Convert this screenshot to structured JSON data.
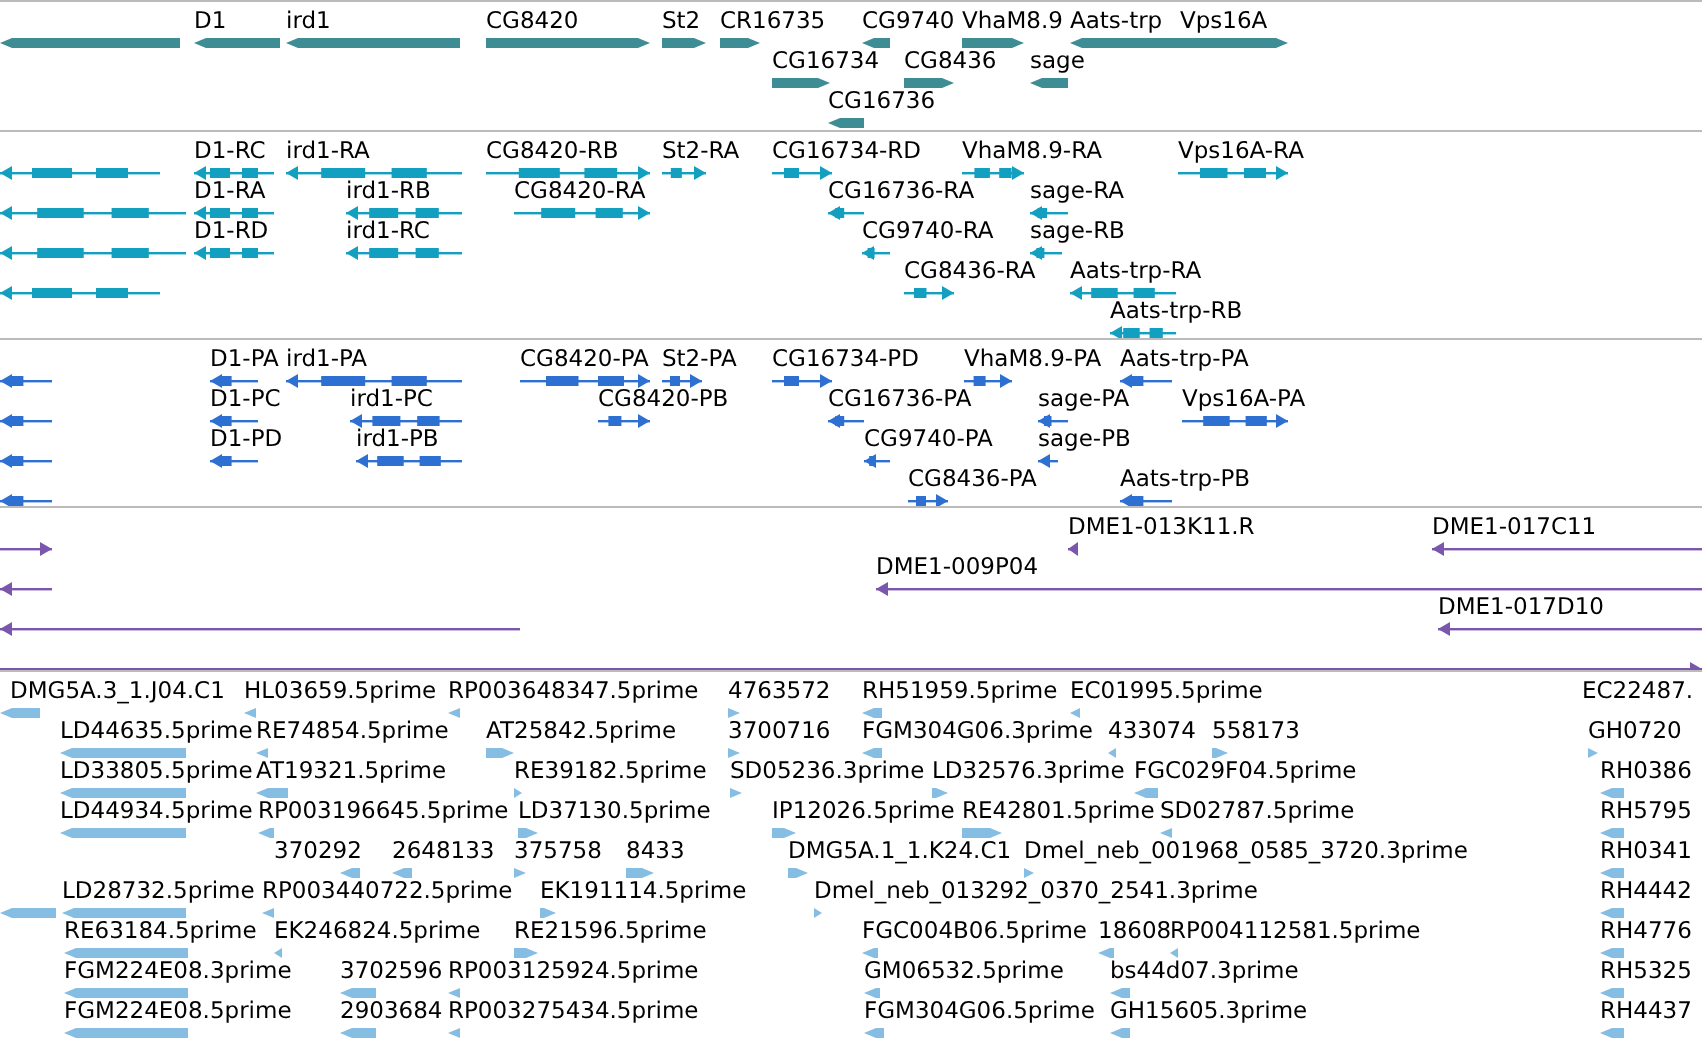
{
  "tracks": [
    {
      "kind": "gene",
      "features": [
        {
          "kind": "reverse"
        },
        {
          "label": "D1",
          "kind": "reverse"
        },
        {
          "label": "ird1",
          "kind": "reverse"
        },
        {
          "label": "CG8420",
          "kind": "forward"
        },
        {
          "label": "St2",
          "kind": "forward"
        },
        {
          "label": "CR16735",
          "kind": "forward"
        },
        {
          "label": "CG9740",
          "kind": "reverse"
        },
        {
          "label": "VhaM8.9",
          "kind": "forward"
        },
        {
          "label": "Aats-trp",
          "kind": "reverse"
        },
        {
          "label": "Vps16A",
          "kind": "forward"
        },
        {
          "label": "CG16734",
          "kind": "forward"
        },
        {
          "label": "CG8436",
          "kind": "forward"
        },
        {
          "label": "sage",
          "kind": "reverse"
        },
        {
          "label": "CG16736",
          "kind": "reverse"
        }
      ]
    },
    {
      "kind": "transcript",
      "features": [
        {
          "kind": "reverse"
        },
        {
          "label": "D1-RC",
          "kind": "reverse"
        },
        {
          "label": "ird1-RA",
          "kind": "reverse"
        },
        {
          "label": "CG8420-RB",
          "kind": "forward"
        },
        {
          "label": "St2-RA",
          "kind": "forward"
        },
        {
          "label": "CG16734-RD",
          "kind": "forward"
        },
        {
          "label": "VhaM8.9-RA",
          "kind": "forward"
        },
        {
          "label": "Vps16A-RA",
          "kind": "forward"
        },
        {
          "kind": "reverse"
        },
        {
          "label": "D1-RA",
          "kind": "reverse"
        },
        {
          "label": "ird1-RB",
          "kind": "reverse"
        },
        {
          "label": "CG8420-RA",
          "kind": "forward"
        },
        {
          "label": "CG16736-RA",
          "kind": "reverse"
        },
        {
          "label": "sage-RA",
          "kind": "reverse"
        },
        {
          "kind": "reverse"
        },
        {
          "label": "D1-RD",
          "kind": "reverse"
        },
        {
          "label": "ird1-RC",
          "kind": "reverse"
        },
        {
          "label": "CG9740-RA",
          "kind": "reverse"
        },
        {
          "label": "sage-RB",
          "kind": "reverse"
        },
        {
          "kind": "reverse"
        },
        {
          "label": "CG8436-RA",
          "kind": "forward"
        },
        {
          "label": "Aats-trp-RA",
          "kind": "reverse"
        },
        {
          "label": "Aats-trp-RB",
          "kind": "reverse"
        }
      ]
    },
    {
      "kind": "protein",
      "features": [
        {
          "kind": "reverse"
        },
        {
          "label": "D1-PA",
          "kind": "reverse"
        },
        {
          "label": "ird1-PA",
          "kind": "reverse"
        },
        {
          "label": "CG8420-PA",
          "kind": "forward"
        },
        {
          "label": "St2-PA",
          "kind": "forward"
        },
        {
          "label": "CG16734-PD",
          "kind": "forward"
        },
        {
          "label": "VhaM8.9-PA",
          "kind": "forward"
        },
        {
          "label": "Aats-trp-PA",
          "kind": "reverse"
        },
        {
          "kind": "reverse"
        },
        {
          "label": "D1-PC",
          "kind": "reverse"
        },
        {
          "label": "ird1-PC",
          "kind": "reverse"
        },
        {
          "label": "CG8420-PB",
          "kind": "forward"
        },
        {
          "label": "CG16736-PA",
          "kind": "reverse"
        },
        {
          "label": "sage-PA",
          "kind": "reverse"
        },
        {
          "label": "Vps16A-PA",
          "kind": "forward"
        },
        {
          "kind": "reverse"
        },
        {
          "label": "D1-PD",
          "kind": "reverse"
        },
        {
          "label": "ird1-PB",
          "kind": "reverse"
        },
        {
          "label": "CG9740-PA",
          "kind": "reverse"
        },
        {
          "label": "sage-PB",
          "kind": "reverse"
        },
        {
          "kind": "reverse"
        },
        {
          "label": "CG8436-PA",
          "kind": "forward"
        },
        {
          "label": "Aats-trp-PB",
          "kind": "reverse"
        }
      ]
    },
    {
      "kind": "clone",
      "features": [
        {
          "kind": "forward"
        },
        {
          "label": "DME1-013K11.R",
          "kind": "reverse"
        },
        {
          "label": "DME1-017C11",
          "kind": "reverse"
        },
        {
          "kind": "reverse"
        },
        {
          "label": "DME1-009P04",
          "kind": "reverse"
        },
        {
          "kind": "reverse"
        },
        {
          "label": "DME1-017D10",
          "kind": "reverse"
        },
        {
          "kind": "forward"
        }
      ]
    },
    {
      "kind": "est",
      "features": [
        {
          "label": "DMG5A.3_1.J04.C1",
          "kind": "reverse"
        },
        {
          "label": "HL03659.5prime",
          "kind": "reverse"
        },
        {
          "label": "RP003648347.5prime",
          "kind": "reverse"
        },
        {
          "label": "4763572",
          "kind": "forward"
        },
        {
          "label": "RH51959.5prime",
          "kind": "reverse"
        },
        {
          "label": "EC01995.5prime",
          "kind": "reverse"
        },
        {
          "label": "EC22487."
        },
        {
          "label": "LD44635.5prime",
          "kind": "reverse"
        },
        {
          "label": "RE74854.5prime",
          "kind": "reverse"
        },
        {
          "label": "AT25842.5prime",
          "kind": "forward"
        },
        {
          "label": "3700716",
          "kind": "forward"
        },
        {
          "label": "FGM304G06.3prime",
          "kind": "reverse"
        },
        {
          "label": "433074",
          "kind": "reverse"
        },
        {
          "label": "558173",
          "kind": "forward"
        },
        {
          "label": "GH0720",
          "kind": "forward"
        },
        {
          "label": "LD33805.5prime",
          "kind": "reverse"
        },
        {
          "label": "AT19321.5prime",
          "kind": "reverse"
        },
        {
          "label": "RE39182.5prime",
          "kind": "forward"
        },
        {
          "label": "SD05236.3prime",
          "kind": "forward"
        },
        {
          "label": "LD32576.3prime",
          "kind": "forward"
        },
        {
          "label": "FGC029F04.5prime",
          "kind": "reverse"
        },
        {
          "label": "RH0386",
          "kind": "reverse"
        },
        {
          "label": "LD44934.5prime",
          "kind": "reverse"
        },
        {
          "label": "RP003196645.5prime",
          "kind": "reverse"
        },
        {
          "label": "LD37130.5prime",
          "kind": "forward"
        },
        {
          "label": "IP12026.5prime",
          "kind": "forward"
        },
        {
          "label": "RE42801.5prime",
          "kind": "forward"
        },
        {
          "label": "SD02787.5prime",
          "kind": "reverse"
        },
        {
          "label": "RH5795",
          "kind": "reverse"
        },
        {
          "label": "370292",
          "kind": "reverse"
        },
        {
          "label": "2648133",
          "kind": "reverse"
        },
        {
          "label": "375758",
          "kind": "forward"
        },
        {
          "label": "8433",
          "kind": "forward"
        },
        {
          "label": "DMG5A.1_1.K24.C1",
          "kind": "forward"
        },
        {
          "label": "Dmel_neb_001968_0585_3720.3prime",
          "kind": "forward"
        },
        {
          "label": "RH0341",
          "kind": "reverse"
        },
        {
          "kind": "reverse"
        },
        {
          "label": "LD28732.5prime",
          "kind": "reverse"
        },
        {
          "label": "RP003440722.5prime",
          "kind": "reverse"
        },
        {
          "label": "EK191114.5prime",
          "kind": "forward"
        },
        {
          "label": "Dmel_neb_013292_0370_2541.3prime",
          "kind": "forward"
        },
        {
          "label": "RH4442",
          "kind": "reverse"
        },
        {
          "label": "RE63184.5prime",
          "kind": "reverse"
        },
        {
          "label": "EK246824.5prime",
          "kind": "reverse"
        },
        {
          "label": "RE21596.5prime",
          "kind": "forward"
        },
        {
          "label": "FGC004B06.5prime",
          "kind": "reverse"
        },
        {
          "label": "18608",
          "kind": "reverse"
        },
        {
          "label": "RP004112581.5prime",
          "kind": "reverse"
        },
        {
          "label": "RH4776",
          "kind": "reverse"
        },
        {
          "label": "FGM224E08.3prime",
          "kind": "reverse"
        },
        {
          "label": "3702596",
          "kind": "reverse"
        },
        {
          "label": "RP003125924.5prime",
          "kind": "reverse"
        },
        {
          "label": "GM06532.5prime",
          "kind": "reverse"
        },
        {
          "label": "bs44d07.3prime",
          "kind": "reverse"
        },
        {
          "label": "RH5325",
          "kind": "reverse"
        },
        {
          "label": "FGM224E08.5prime",
          "kind": "reverse"
        },
        {
          "label": "2903684",
          "kind": "reverse"
        },
        {
          "label": "RP003275434.5prime",
          "kind": "reverse"
        },
        {
          "label": "FGM304G06.5prime",
          "kind": "reverse"
        },
        {
          "label": "GH15605.3prime",
          "kind": "reverse"
        },
        {
          "label": "RH4437",
          "kind": "reverse"
        }
      ]
    }
  ]
}
